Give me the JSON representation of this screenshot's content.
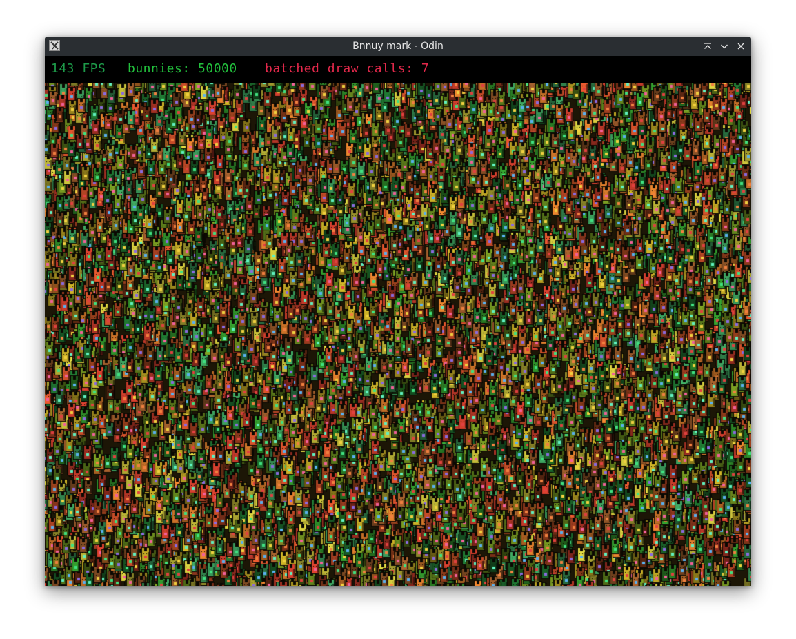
{
  "window": {
    "title": "Bnnuy mark - Odin",
    "app_icon": "x11-icon",
    "controls": {
      "keep_above_icon": "keep-above-icon",
      "minimize_icon": "chevron-down-icon",
      "close_icon": "close-icon"
    }
  },
  "hud": {
    "fps_text": "143 FPS",
    "bunnies_text": "bunnies: 50000",
    "draw_calls_text": "batched draw calls: 7",
    "colors": {
      "fps": "#1d9a49",
      "bunnies": "#22c03c",
      "draw_calls": "#e0284a"
    }
  },
  "scene": {
    "bunny_count": 50000,
    "palette": [
      "#c23a2a",
      "#d4782a",
      "#b8a023",
      "#6f8f1f",
      "#2f8f2a",
      "#1d6e2e",
      "#8a3a1a",
      "#c8c03a",
      "#3a9a5a",
      "#9a5a2a",
      "#5a7a1a",
      "#d0502a"
    ],
    "belly_palette": [
      "#f0609a",
      "#5ab0f0",
      "#8a6ae0",
      "#40e080",
      "#f0d040",
      "#e04040",
      "#60f0c0",
      "#f08040"
    ]
  }
}
